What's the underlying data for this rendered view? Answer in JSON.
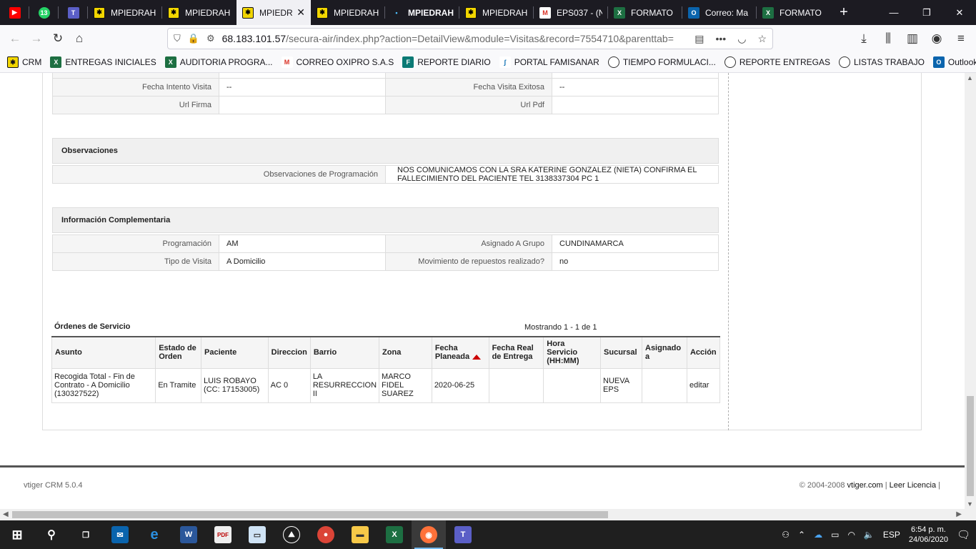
{
  "browser": {
    "tabs": [
      {
        "label": "",
        "icon": "youtube-icon",
        "pinned": true
      },
      {
        "label": "13",
        "icon": "whatsapp-icon",
        "pinned": true
      },
      {
        "label": "",
        "icon": "teams-icon",
        "pinned": true
      },
      {
        "label": "MPIEDRAH",
        "icon": "vtiger-icon"
      },
      {
        "label": "MPIEDRAH",
        "icon": "vtiger-icon"
      },
      {
        "label": "MPIEDR",
        "icon": "vtiger-icon",
        "active": true
      },
      {
        "label": "MPIEDRAH",
        "icon": "vtiger-icon"
      },
      {
        "label": "MPIEDRAH",
        "icon": "dot-icon"
      },
      {
        "label": "MPIEDRAH",
        "icon": "vtiger-icon"
      },
      {
        "label": "EPS037 - (N",
        "icon": "gmail-icon"
      },
      {
        "label": "FORMATO",
        "icon": "excel-icon"
      },
      {
        "label": "Correo: Ma",
        "icon": "outlook-icon"
      },
      {
        "label": "FORMATO",
        "icon": "excel-icon"
      }
    ],
    "url_host": "68.183.101.57",
    "url_path": "/secura-air/index.php?action=DetailView&module=Visitas&record=7554710&parenttab=",
    "bookmarks": [
      {
        "label": "CRM",
        "icon": "vtiger-icon"
      },
      {
        "label": "ENTREGAS INICIALES",
        "icon": "excel-icon"
      },
      {
        "label": "AUDITORIA PROGRA...",
        "icon": "excel-icon"
      },
      {
        "label": "CORREO OXIPRO S.A.S",
        "icon": "gmail-icon"
      },
      {
        "label": "REPORTE DIARIO",
        "icon": "forms-icon"
      },
      {
        "label": "PORTAL FAMISANAR",
        "icon": "famisanar-icon"
      },
      {
        "label": "TIEMPO FORMULACI...",
        "icon": "globe-icon"
      },
      {
        "label": "REPORTE ENTREGAS",
        "icon": "globe-icon"
      },
      {
        "label": "LISTAS TRABAJO",
        "icon": "globe-icon"
      },
      {
        "label": "Outlook",
        "icon": "outlook-icon"
      }
    ]
  },
  "details_top": [
    {
      "l1": "Fecha Intento Visita",
      "v1": "--",
      "l2": "Fecha Visita Exitosa",
      "v2": "--"
    },
    {
      "l1": "Url Firma",
      "v1": "",
      "l2": "Url Pdf",
      "v2": ""
    }
  ],
  "observaciones": {
    "title": "Observaciones",
    "label": "Observaciones de Programación",
    "value": "NOS COMUNICAMOS CON LA SRA KATERINE GONZALEZ (NIETA) CONFIRMA EL FALLECIMIENTO DEL PACIENTE TEL 3138337304 PC 1"
  },
  "complementaria": {
    "title": "Información Complementaria",
    "rows": [
      {
        "l1": "Programación",
        "v1": "AM",
        "l2": "Asignado A Grupo",
        "v2": "CUNDINAMARCA"
      },
      {
        "l1": "Tipo de Visita",
        "v1": "A Domicilio",
        "l2": "Movimiento de repuestos realizado?",
        "v2": "no"
      }
    ]
  },
  "ordenes": {
    "title": "Órdenes de Servicio",
    "count": "Mostrando 1 - 1 de 1",
    "headers": [
      "Asunto",
      "Estado de Orden",
      "Paciente",
      "Direccion",
      "Barrio",
      "Zona",
      "Fecha Planeada",
      "Fecha Real de Entrega",
      "Hora Servicio (HH:MM)",
      "Sucursal",
      "Asignado a",
      "Acción"
    ],
    "rows": [
      [
        "Recogida Total - Fin de Contrato - A Domicilio (130327522)",
        "En Tramite",
        "LUIS ROBAYO (CC: 17153005)",
        "AC 0",
        "LA RESURRECCION II",
        "MARCO FIDEL SUAREZ",
        "2020-06-25",
        "",
        "",
        "NUEVA EPS",
        "",
        "editar"
      ]
    ]
  },
  "footer": {
    "version": "vtiger CRM 5.0.4",
    "copyright": "© 2004-2008",
    "site": "vtiger.com",
    "license": "Leer Licencia"
  },
  "taskbar": {
    "lang": "ESP",
    "time": "6:54 p. m.",
    "date": "24/06/2020"
  }
}
